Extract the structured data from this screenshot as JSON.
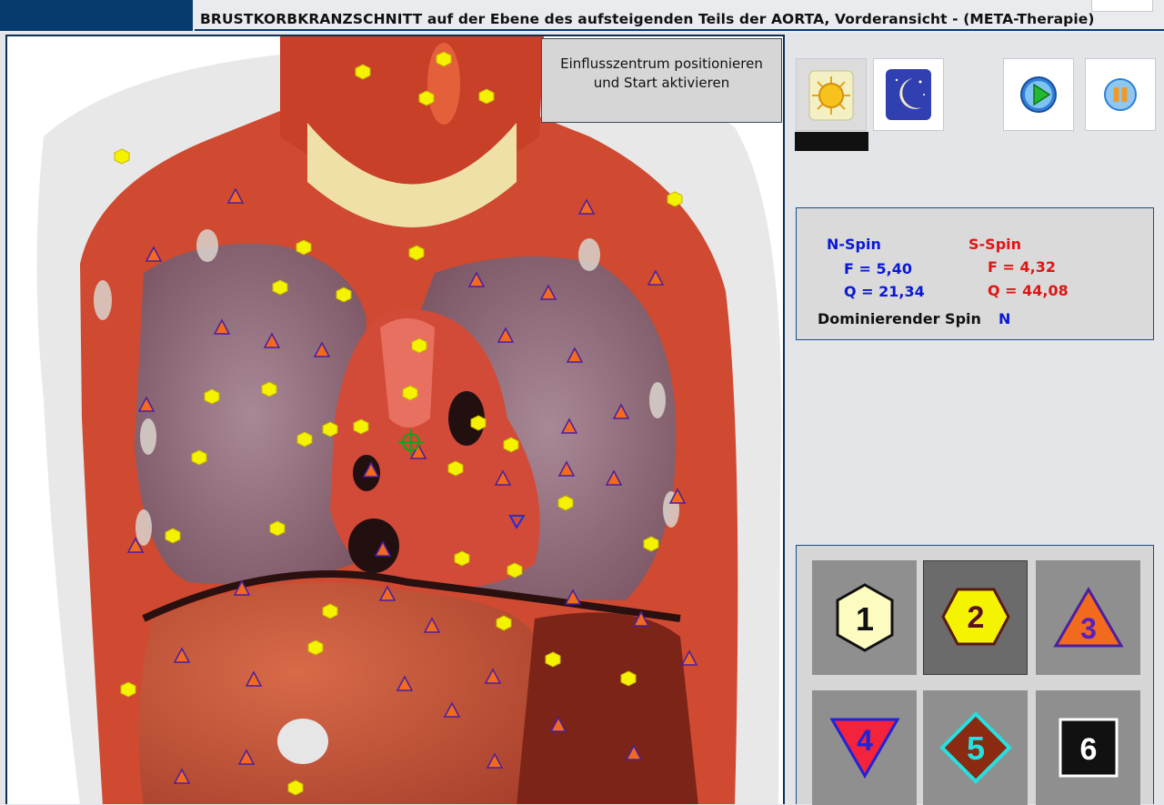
{
  "window": {
    "title": "BRUSTKORBKRANZSCHNITT auf der Ebene des aufsteigenden Teils der AORTA, Vorderansicht - (META-Therapie)"
  },
  "hint": {
    "line1": "Einflusszentrum positionieren",
    "line2": "und Start aktivieren"
  },
  "controls": [
    {
      "icon": "sun-icon",
      "active": true
    },
    {
      "icon": "moon-icon",
      "active": false
    },
    {
      "icon": "play-icon",
      "active": false
    },
    {
      "icon": "pause-icon",
      "active": false
    }
  ],
  "spin": {
    "n_title": "N-Spin",
    "s_title": "S-Spin",
    "n_f": "F =  5,40",
    "n_q": "Q = 21,34",
    "s_f": "F =  4,32",
    "s_q": "Q = 44,08",
    "dominant_label": "Dominierender Spin",
    "dominant_value": "N",
    "colors": {
      "n": "#0a19d6",
      "s": "#e01515"
    }
  },
  "markers": {
    "buttons": [
      {
        "label": "1",
        "shape": "hexagon",
        "fill": "#fdfcc0",
        "selected": false
      },
      {
        "label": "2",
        "shape": "hexagon",
        "fill": "#f4f400",
        "selected": true
      },
      {
        "label": "3",
        "shape": "triangle-up",
        "fill": "#f26a1e",
        "selected": false
      },
      {
        "label": "4",
        "shape": "triangle-down",
        "fill": "#f2233a",
        "selected": false
      },
      {
        "label": "5",
        "shape": "diamond",
        "fill": "#8a2a10",
        "selected": false
      },
      {
        "label": "6",
        "shape": "square",
        "fill": "#111111",
        "selected": false
      }
    ]
  },
  "colors": {
    "accent": "#073b6f",
    "marker_hexagon": "#f5f200",
    "marker_triangle": "#f26a1e"
  }
}
